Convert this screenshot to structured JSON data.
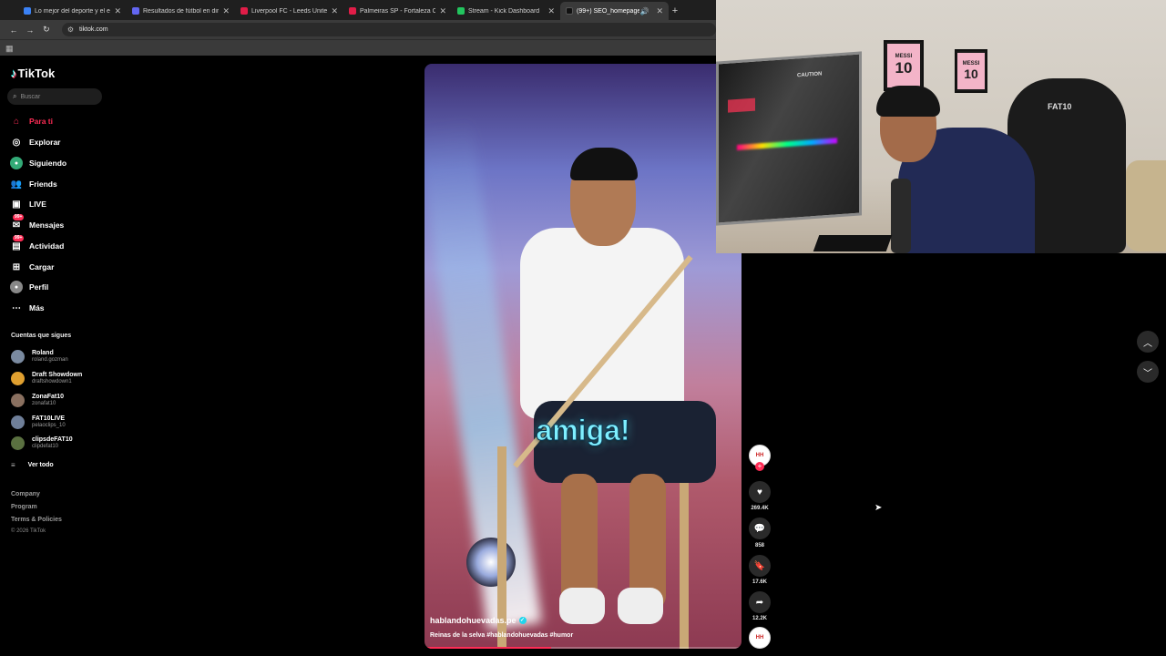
{
  "browser": {
    "tabs": [
      {
        "title": "Lo mejor del deporte y el entr",
        "fav_color": "#3b82f6",
        "active": false
      },
      {
        "title": "Resultados de fútbol en directo",
        "fav_color": "#6366f1",
        "active": false
      },
      {
        "title": "Liverpool FC - Leeds United Co",
        "fav_color": "#e11d48",
        "active": false
      },
      {
        "title": "Palmeiras SP - Fortaleza CE Co",
        "fav_color": "#e11d48",
        "active": false
      },
      {
        "title": "Stream - Kick Dashboard",
        "fav_color": "#22c55e",
        "active": false
      },
      {
        "title": "(99+) SEO_homepage_title",
        "fav_color": "#111111",
        "active": true
      }
    ],
    "url": "tiktok.com"
  },
  "tiktok": {
    "logo": "TikTok",
    "search_placeholder": "Buscar",
    "nav": [
      {
        "label": "Para ti",
        "icon": "home-icon",
        "active": true
      },
      {
        "label": "Explorar",
        "icon": "compass-icon"
      },
      {
        "label": "Siguiendo",
        "icon": "following-icon"
      },
      {
        "label": "Friends",
        "icon": "friends-icon"
      },
      {
        "label": "LIVE",
        "icon": "live-icon"
      },
      {
        "label": "Mensajes",
        "icon": "messages-icon",
        "badge": "99+"
      },
      {
        "label": "Actividad",
        "icon": "activity-icon",
        "badge": "99+"
      },
      {
        "label": "Cargar",
        "icon": "upload-icon"
      },
      {
        "label": "Perfil",
        "icon": "profile-icon"
      },
      {
        "label": "Más",
        "icon": "more-icon"
      }
    ],
    "following_title": "Cuentas que sigues",
    "following": [
      {
        "name": "Roland",
        "handle": "roland.gozman",
        "color": "#7a8aa0"
      },
      {
        "name": "Draft Showdown",
        "handle": "draftshowdown1",
        "color": "#e0a030"
      },
      {
        "name": "ZonaFat10",
        "handle": "zonafat10",
        "color": "#8a7060"
      },
      {
        "name": "FAT10LIVE",
        "handle": "pelaoclips_10",
        "color": "#6f7f99"
      },
      {
        "name": "clipsdeFAT10",
        "handle": "clipdefat10",
        "color": "#5a7040"
      }
    ],
    "see_all": "Ver todo",
    "footer": [
      "Company",
      "Program",
      "Terms & Policies"
    ],
    "copyright": "© 2026 TikTok"
  },
  "video": {
    "caption": "amiga!",
    "author": "hablandohuevadas.pe",
    "description": "Reinas de la selva #hablandohuevadas #humor",
    "progress": 0.4,
    "likes": "269.4K",
    "comments": "858",
    "saves": "17.6K",
    "shares": "12.2K"
  },
  "webcam": {
    "frame1_label": "MESSI",
    "frame1_number": "10",
    "frame2_label": "MESSI",
    "frame2_number": "10",
    "chair_label": "FAT10",
    "case_label": "CAUTION"
  },
  "colors": {
    "accent": "#fe2c55",
    "teal": "#25f4ee"
  }
}
